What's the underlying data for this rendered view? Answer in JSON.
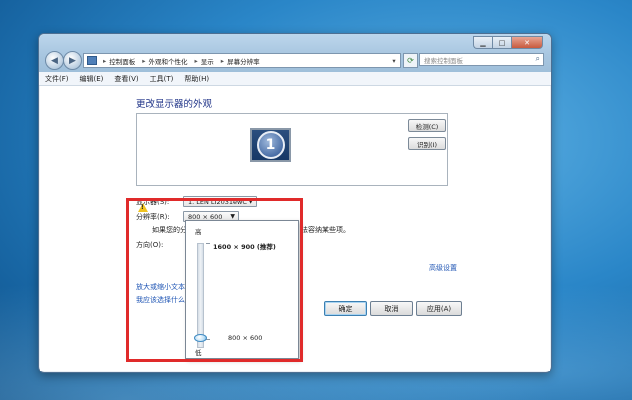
{
  "window": {
    "address": {
      "crumbs": [
        "控制面板",
        "外观和个性化",
        "显示",
        "屏幕分辨率"
      ]
    },
    "search_placeholder": "搜索控制面板",
    "menu": [
      "文件(F)",
      "编辑(E)",
      "查看(V)",
      "工具(T)",
      "帮助(H)"
    ]
  },
  "main": {
    "heading": "更改显示器的外观",
    "monitor_number": "1",
    "detect_button": "检测(C)",
    "identify_button": "识别(I)",
    "display_label": "显示器(S):",
    "display_value": "1. LEN LI2031ewC",
    "resolution_label": "分辨率(R):",
    "resolution_value": "800 × 600",
    "warning_text": "如果您的分",
    "warning_text_tail": "法容纳某些项。",
    "orientation_label": "方向(O):",
    "advanced_link": "高级设置",
    "link1": "放大或缩小文本",
    "link2": "我应该选择什么",
    "ok_button": "确定",
    "cancel_button": "取消",
    "apply_button": "应用(A)"
  },
  "slider_popup": {
    "high_label": "高",
    "low_label": "低",
    "top_option": "1600 × 900 (推荐)",
    "bottom_option": "800 × 600",
    "selected_fraction": 0
  },
  "colors": {
    "highlight_box": "#e02a2a",
    "link": "#1f55b4",
    "heading": "#1e3287"
  }
}
